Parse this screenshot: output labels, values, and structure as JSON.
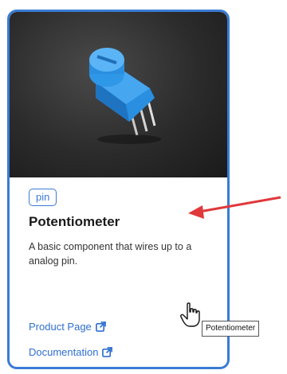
{
  "card": {
    "tag": "pin",
    "title": "Potentiometer",
    "description": "A basic component that wires up to a analog pin.",
    "links": {
      "product": "Product Page",
      "docs": "Documentation"
    }
  },
  "tooltip": {
    "text": "Potentiometer"
  },
  "colors": {
    "accent": "#3a7bd5",
    "link": "#2f6fcf",
    "arrow": "#e0383b",
    "component": "#2a8fe0"
  },
  "icons": {
    "external": "external-link-icon",
    "cursor": "hand-pointer-icon",
    "arrow": "red-arrow-annotation"
  }
}
